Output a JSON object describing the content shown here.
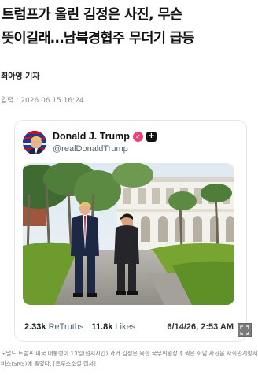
{
  "article": {
    "headline_line1": "트럼프가 올린 김정은 사진, 무슨",
    "headline_line2": "뜻이길래…남북경협주 무더기 급등",
    "author": "최아영 기자",
    "date": "입력 : 2026.06.15 16:24"
  },
  "tweet": {
    "name": "Donald J. Trump",
    "handle": "@realDonaldTrump",
    "retruths_value": "2.33k",
    "retruths_label": "ReTruths",
    "likes_value": "11.8k",
    "likes_label": "Likes",
    "date": "6/14/26, 2:53 AM",
    "badge_color": "#e8447a"
  },
  "caption": {
    "line1": "도널드 트럼프 미국 대통령이 13일(현지시간) 과거 김정은 북한 국무위원장과 찍은 회담 사진을 사회관계망서",
    "line2": "비스(SNS)에 올렸다. [트루스소셜 캡처]"
  },
  "icons": {
    "verified": "verified-badge-icon",
    "platform": "truth-social-icon",
    "expand": "expand-icon"
  }
}
